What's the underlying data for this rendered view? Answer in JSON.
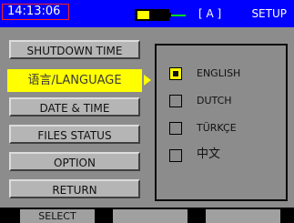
{
  "status_bar": {
    "time": "14:13:06",
    "battery_level": 0.4,
    "mode": "[ A ]",
    "title": "SETUP"
  },
  "menu": {
    "items": [
      {
        "label": "SHUTDOWN TIME",
        "selected": false
      },
      {
        "label": "语言/LANGUAGE",
        "selected": true
      },
      {
        "label": "DATE & TIME",
        "selected": false
      },
      {
        "label": "FILES STATUS",
        "selected": false
      },
      {
        "label": "OPTION",
        "selected": false
      },
      {
        "label": "RETURN",
        "selected": false
      }
    ]
  },
  "language_panel": {
    "options": [
      {
        "label": "ENGLISH",
        "checked": true
      },
      {
        "label": "DUTCH",
        "checked": false
      },
      {
        "label": "TÜRKÇE",
        "checked": false
      },
      {
        "label": "中文",
        "checked": false
      }
    ]
  },
  "softkeys": [
    {
      "label": "SELECT"
    },
    {
      "label": ""
    },
    {
      "label": ""
    },
    {
      "label": ""
    }
  ],
  "colors": {
    "status_bar": "#0000ff",
    "highlight": "#ffff00",
    "background": "#8c8c8c"
  }
}
